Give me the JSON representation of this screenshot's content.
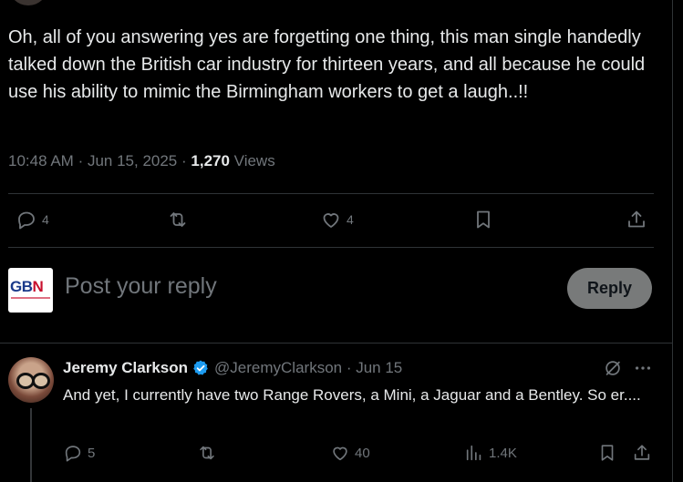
{
  "tweet": {
    "text": "Oh, all of you answering yes are forgetting one thing, this man single handedly talked down the British car industry for thirteen years, and all because he could use his ability to mimic the Birmingham workers to get a laugh..!!",
    "time": "10:48 AM",
    "date": "Jun 15, 2025",
    "views_count": "1,270",
    "views_label": "Views",
    "replies": "4",
    "likes": "4"
  },
  "composer": {
    "avatar_text": "GBN",
    "placeholder": "Post your reply",
    "button": "Reply"
  },
  "reply": {
    "name": "Jeremy Clarkson",
    "handle": "@JeremyClarkson",
    "date": "Jun 15",
    "text": "And yet, I currently have two Range Rovers, a Mini, a Jaguar and a Bentley. So er....",
    "replies": "5",
    "likes": "40",
    "views": "1.4K"
  },
  "colors": {
    "background": "#000000",
    "text": "#e7e9ea",
    "muted": "#71767b",
    "verified": "#1d9bf0",
    "reply_button": "#787a7a"
  }
}
